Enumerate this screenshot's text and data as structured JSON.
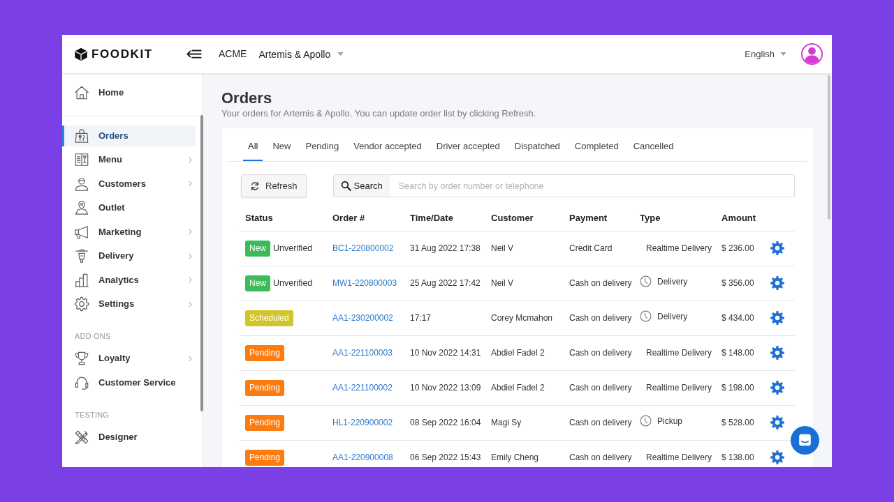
{
  "header": {
    "brand": "FOODKIT",
    "company": "ACME",
    "outlet": "Artemis & Apollo",
    "language": "English"
  },
  "sidebar": {
    "groups": [
      {
        "items": [
          {
            "label": "Home",
            "selected": false,
            "expandable": false
          }
        ]
      },
      {
        "items": [
          {
            "label": "Orders",
            "selected": true,
            "expandable": false
          },
          {
            "label": "Menu",
            "selected": false,
            "expandable": true
          },
          {
            "label": "Customers",
            "selected": false,
            "expandable": true
          },
          {
            "label": "Outlet",
            "selected": false,
            "expandable": false
          },
          {
            "label": "Marketing",
            "selected": false,
            "expandable": true
          },
          {
            "label": "Delivery",
            "selected": false,
            "expandable": true
          },
          {
            "label": "Analytics",
            "selected": false,
            "expandable": true
          },
          {
            "label": "Settings",
            "selected": false,
            "expandable": true
          }
        ]
      },
      {
        "heading": "ADD ONS",
        "items": [
          {
            "label": "Loyalty",
            "selected": false,
            "expandable": true
          },
          {
            "label": "Customer Service",
            "selected": false,
            "expandable": false
          }
        ]
      },
      {
        "heading": "TESTING",
        "items": [
          {
            "label": "Designer",
            "selected": false,
            "expandable": false
          }
        ]
      }
    ]
  },
  "page": {
    "title": "Orders",
    "subtitle": "Your orders for Artemis & Apollo. You can update order list by clicking Refresh."
  },
  "tabs": [
    {
      "label": "All",
      "selected": true
    },
    {
      "label": "New",
      "selected": false
    },
    {
      "label": "Pending",
      "selected": false
    },
    {
      "label": "Vendor accepted",
      "selected": false
    },
    {
      "label": "Driver accepted",
      "selected": false
    },
    {
      "label": "Dispatched",
      "selected": false
    },
    {
      "label": "Completed",
      "selected": false
    },
    {
      "label": "Cancelled",
      "selected": false
    }
  ],
  "refresh_button": "Refresh",
  "search": {
    "button": "Search",
    "placeholder": "Search by order number or telephone"
  },
  "table": {
    "columns": [
      "Status",
      "Order #",
      "Time/Date",
      "Customer",
      "Payment",
      "Type",
      "Amount"
    ],
    "rows": [
      {
        "status": {
          "label": "New",
          "color": "#3dba5a"
        },
        "verification": "Unverified",
        "order": "BC1-220800002",
        "time": "31 Aug 2022 17:38",
        "customer": "Neil V",
        "payment": "Credit Card",
        "type": {
          "label": "Realtime Delivery",
          "scheduled": false
        },
        "amount": "$ 236.00"
      },
      {
        "status": {
          "label": "New",
          "color": "#3dba5a"
        },
        "verification": "Unverified",
        "order": "MW1-220800003",
        "time": "25 Aug 2022 17:42",
        "customer": "Neil V",
        "payment": "Cash on delivery",
        "type": {
          "label": "Delivery",
          "scheduled": true
        },
        "amount": "$ 356.00"
      },
      {
        "status": {
          "label": "Scheduled",
          "color": "#d2c42b"
        },
        "order": "AA1-230200002",
        "time": "17:17",
        "customer": "Corey Mcmahon",
        "payment": "Cash on delivery",
        "type": {
          "label": "Delivery",
          "scheduled": true
        },
        "amount": "$ 434.00"
      },
      {
        "status": {
          "label": "Pending",
          "color": "#fd7c10"
        },
        "order": "AA1-221100003",
        "time": "10 Nov 2022 14:31",
        "customer": "Abdiel Fadel 2",
        "payment": "Cash on delivery",
        "type": {
          "label": "Realtime Delivery",
          "scheduled": false
        },
        "amount": "$ 148.00"
      },
      {
        "status": {
          "label": "Pending",
          "color": "#fd7c10"
        },
        "order": "AA1-221100002",
        "time": "10 Nov 2022 13:09",
        "customer": "Abdiel Fadel 2",
        "payment": "Cash on delivery",
        "type": {
          "label": "Realtime Delivery",
          "scheduled": false
        },
        "amount": "$ 198.00"
      },
      {
        "status": {
          "label": "Pending",
          "color": "#fd7c10"
        },
        "order": "HL1-220900002",
        "time": "08 Sep 2022 16:04",
        "customer": "Magi Sy",
        "payment": "Cash on delivery",
        "type": {
          "label": "Pickup",
          "scheduled": true
        },
        "amount": "$ 528.00"
      },
      {
        "status": {
          "label": "Pending",
          "color": "#fd7c10"
        },
        "order": "AA1-220900008",
        "time": "06 Sep 2022 15:43",
        "customer": "Emily Cheng",
        "payment": "Cash on delivery",
        "type": {
          "label": "Realtime Delivery",
          "scheduled": false
        },
        "amount": "$ 138.00"
      }
    ]
  }
}
